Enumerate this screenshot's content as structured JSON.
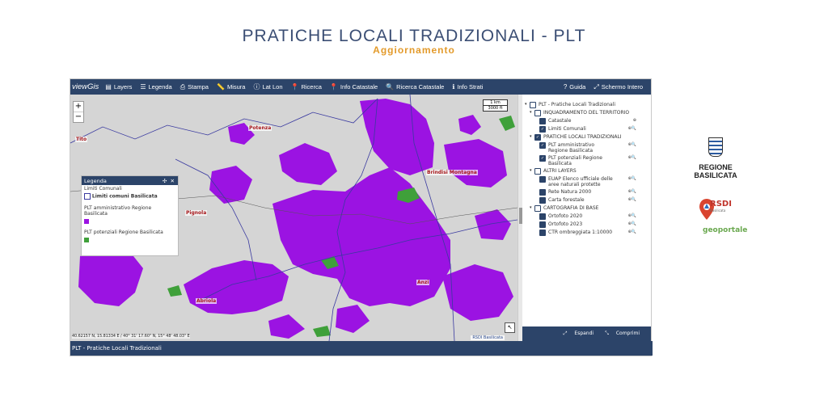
{
  "page": {
    "title": "PRATICHE LOCALI TRADIZIONALI - PLT",
    "subtitle": "Aggiornamento"
  },
  "toolbar": {
    "logo": "viewGis",
    "items": [
      {
        "label": "Layers",
        "icon": "layers-icon"
      },
      {
        "label": "Legenda",
        "icon": "list-icon"
      },
      {
        "label": "Stampa",
        "icon": "print-icon"
      },
      {
        "label": "Misura",
        "icon": "ruler-icon"
      },
      {
        "label": "Lat Lon",
        "icon": "info-icon"
      },
      {
        "label": "Ricerca",
        "icon": "pin-icon"
      },
      {
        "label": "Info Catastale",
        "icon": "pin-icon"
      },
      {
        "label": "Ricerca Catastale",
        "icon": "search-icon"
      },
      {
        "label": "Info Strati",
        "icon": "info-icon"
      }
    ],
    "right_items": [
      {
        "label": "Guida",
        "icon": "help-icon"
      },
      {
        "label": "Schermo Intero",
        "icon": "fullscreen-icon"
      }
    ]
  },
  "map": {
    "zoom_in": "+",
    "zoom_out": "−",
    "scale_km": "1 km",
    "scale_ft": "3000 ft",
    "places": [
      "Tito",
      "Potenza",
      "Brindisi Montagna",
      "Pignola",
      "Abriola",
      "Anzi"
    ],
    "coords": "40.62157 N, 15.81334 E / 40° 31' 17.60\" N, 15° 48' 48.03\" E",
    "attribution": "RSDI Basilicata",
    "colors": {
      "purple": "#9b13e2",
      "green": "#3fa03a",
      "bg": "#d5d5d5",
      "boundary": "#3a3aa0"
    }
  },
  "legend": {
    "title": "Legenda",
    "section": "Limiti Comunali",
    "item1": "Limiti comuni Basilicata",
    "item2": "PLT amministrativo Regione Basilicata",
    "item3": "PLT potenziali Regione Basilicata"
  },
  "tree": {
    "root": "PLT - Pratiche Locali Tradizionali",
    "groups": [
      {
        "label": "INQUADRAMENTO DEL TERRITORIO",
        "items": [
          {
            "label": "Catastale",
            "checked": false,
            "actions": "⊕"
          },
          {
            "label": "Limiti Comunali",
            "checked": true,
            "actions": "⊕🔍"
          }
        ]
      },
      {
        "label": "PRATICHE LOCALI TRADIZIONALI",
        "items": [
          {
            "label": "PLT amministrativo Regione Basilicata",
            "checked": true,
            "actions": "⊕🔍"
          },
          {
            "label": "PLT potenziali Regione Basilicata",
            "checked": true,
            "actions": "⊕🔍"
          }
        ]
      },
      {
        "label": "ALTRI LAYERS",
        "items": [
          {
            "label": "EUAP Elenco ufficiale delle aree naturali protette",
            "checked": false,
            "actions": "⊕🔍"
          },
          {
            "label": "Rete Natura 2000",
            "checked": false,
            "actions": "⊕🔍"
          },
          {
            "label": "Carta forestale",
            "checked": false,
            "actions": "⊕🔍"
          }
        ]
      },
      {
        "label": "CARTOGRAFIA DI BASE",
        "items": [
          {
            "label": "Ortofoto 2020",
            "checked": false,
            "actions": "⊕🔍"
          },
          {
            "label": "Ortofoto 2023",
            "checked": false,
            "actions": "⊕🔍"
          },
          {
            "label": "CTR ombreggiata 1:10000",
            "checked": false,
            "actions": "⊕🔍"
          }
        ]
      }
    ]
  },
  "panel_footer": {
    "expand": "Espandi",
    "collapse": "Comprimi"
  },
  "status_bar": "PLT - Pratiche Locali Tradizionali",
  "logos": {
    "region": "REGIONE BASILICATA",
    "rsdi": "RSDI",
    "rsdi_sub": "Basilicata",
    "geo": "geoportale"
  }
}
